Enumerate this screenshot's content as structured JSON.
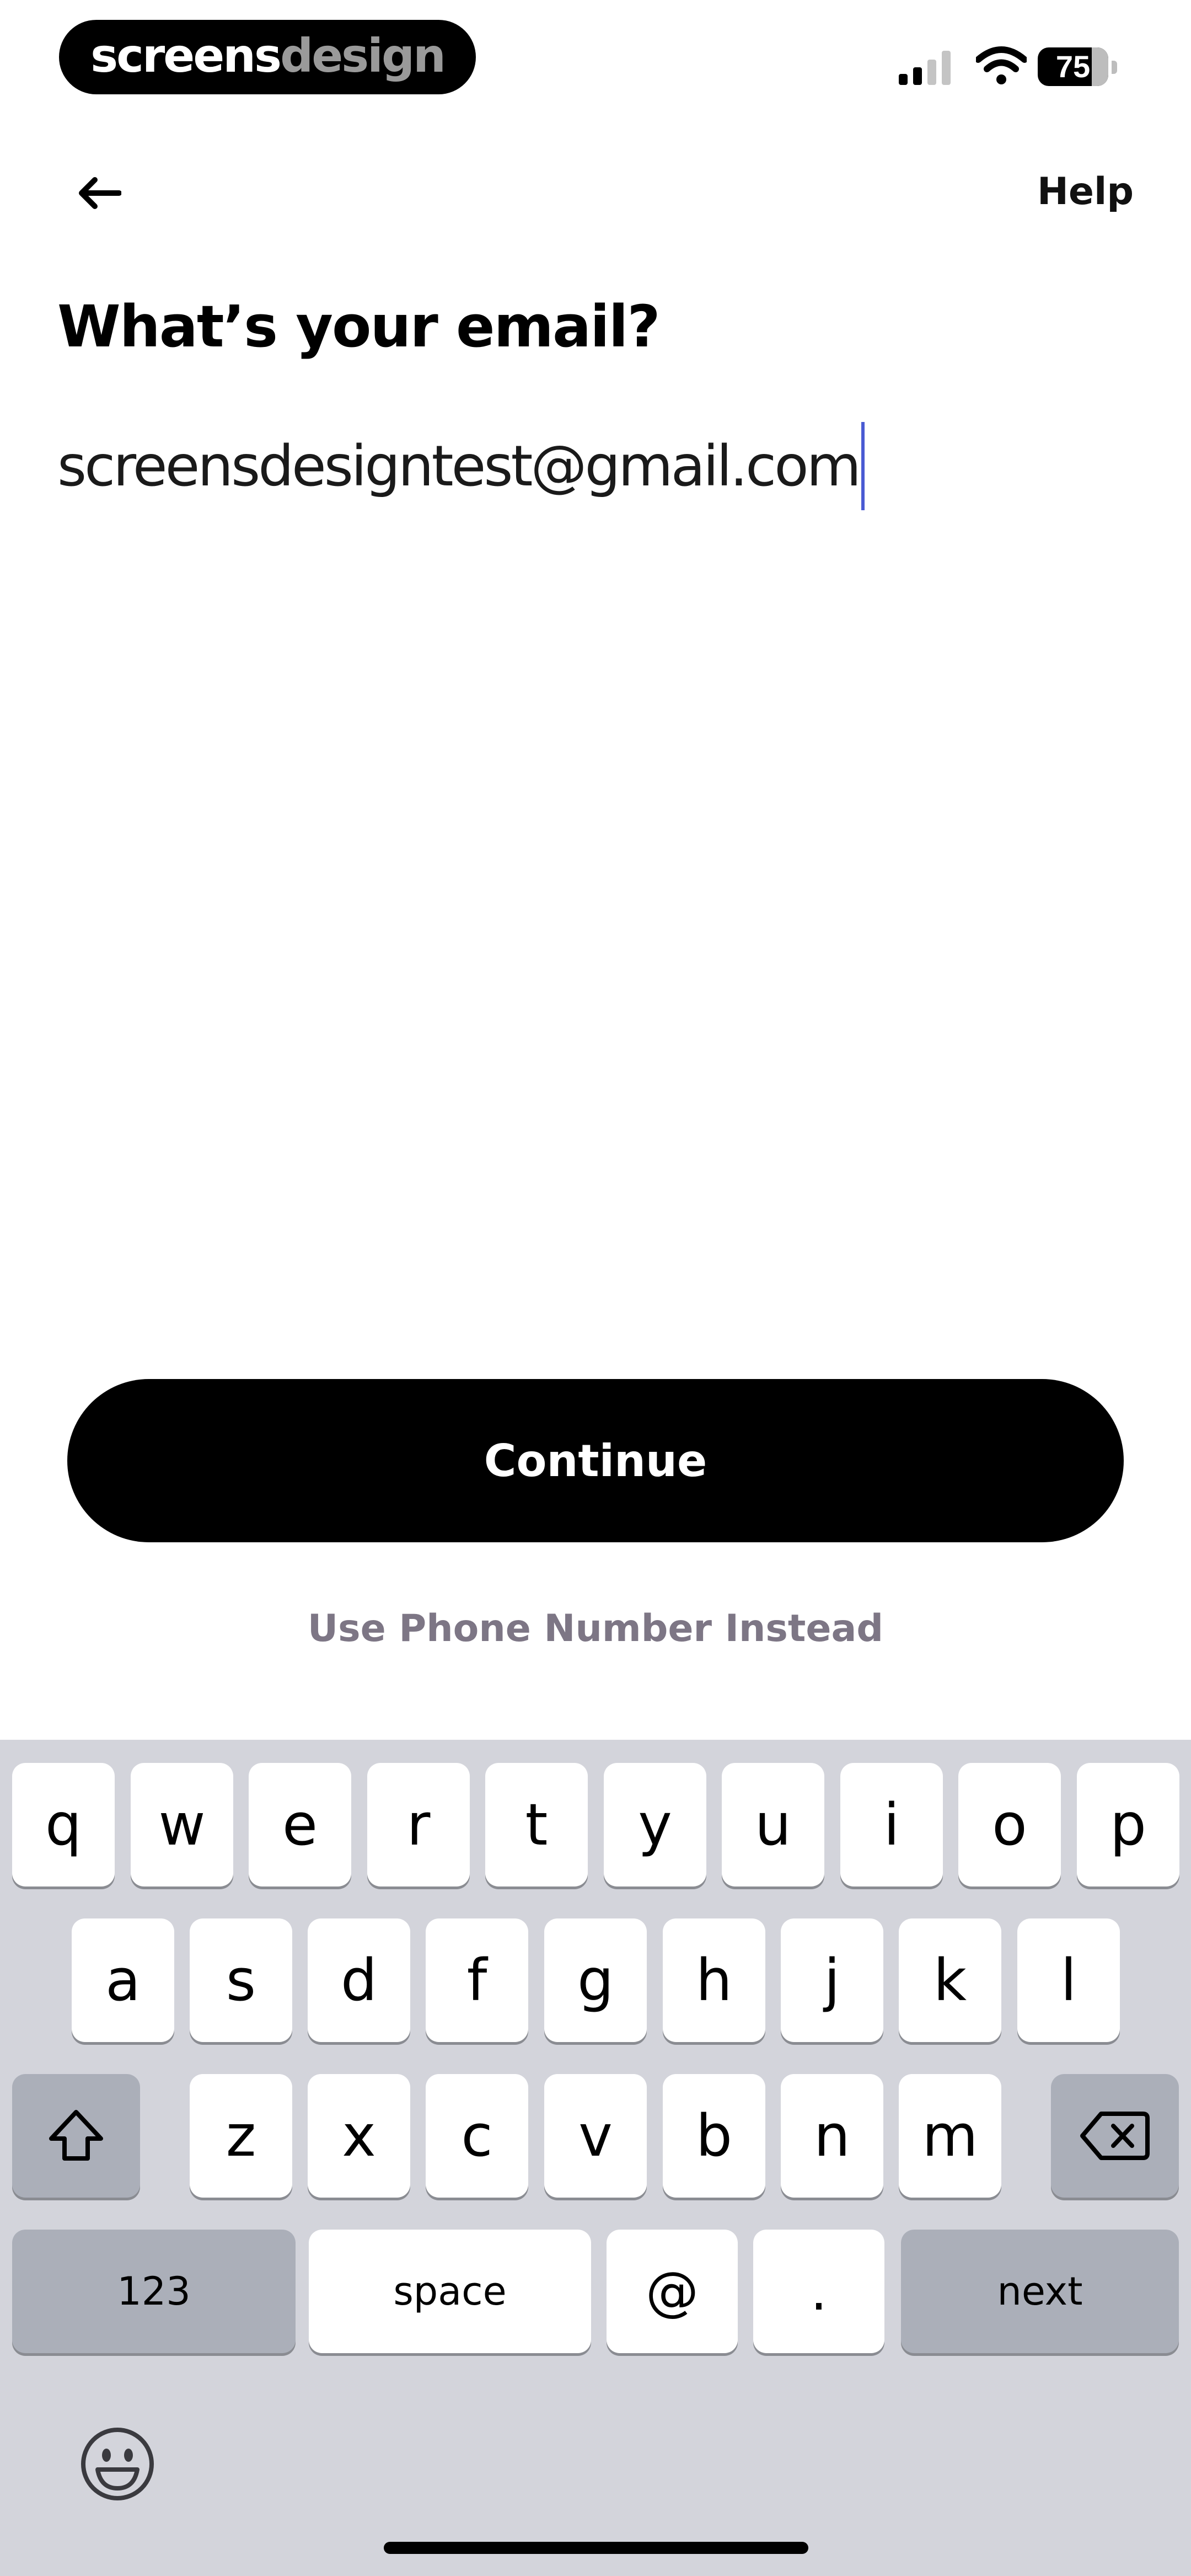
{
  "status_bar": {
    "brand_primary": "screens",
    "brand_secondary": "design",
    "battery_level": "75",
    "icons": [
      "signal-icon",
      "wifi-icon",
      "battery-icon"
    ]
  },
  "nav": {
    "back_icon": "arrow-left-icon",
    "help_label": "Help"
  },
  "main": {
    "title": "What’s your email?",
    "email_value": "screensdesigntest@gmail.com",
    "continue_label": "Continue",
    "alt_link_label": "Use Phone Number Instead"
  },
  "keyboard": {
    "row1": [
      "q",
      "w",
      "e",
      "r",
      "t",
      "y",
      "u",
      "i",
      "o",
      "p"
    ],
    "row2": [
      "a",
      "s",
      "d",
      "f",
      "g",
      "h",
      "j",
      "k",
      "l"
    ],
    "row3": [
      "z",
      "x",
      "c",
      "v",
      "b",
      "n",
      "m"
    ],
    "row4": [
      "123",
      "space",
      "@",
      ".",
      "next"
    ],
    "icons": [
      "shift-icon",
      "delete-icon",
      "emoji-icon"
    ]
  },
  "colors": {
    "button_bg": "#000000",
    "button_text": "#ffffff",
    "link_text": "#7d7685",
    "cursor": "#4a5bd3",
    "keyboard_bg": "#d3d4db",
    "key_bg": "#ffffff",
    "key_dark_bg": "#abafb9"
  }
}
